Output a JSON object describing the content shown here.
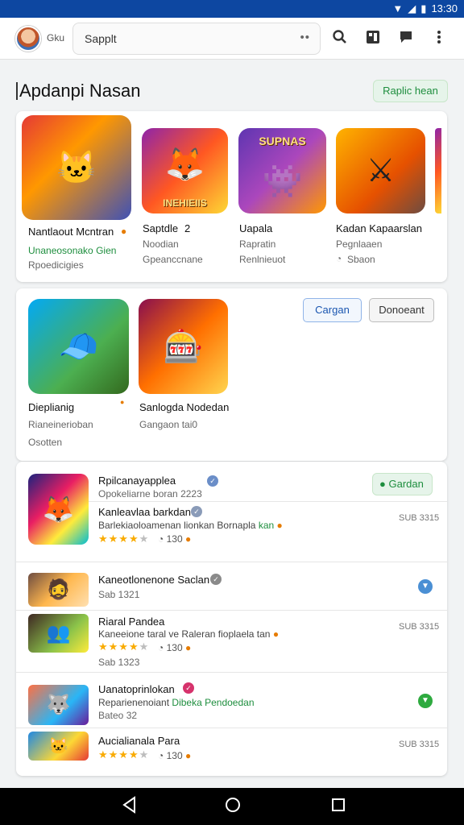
{
  "status": {
    "time": "13:30",
    "wifi_icon": "wifi-icon",
    "signal_icon": "signal-icon",
    "battery_icon": "battery-icon"
  },
  "appbar": {
    "account_label": "Gku",
    "search_value": "Sapplt",
    "search_more": "••",
    "icons": [
      "search-icon",
      "apps-icon",
      "chat-icon",
      "more-vert-icon"
    ]
  },
  "featured": {
    "title": "Apdanpi Nasan",
    "action": "Raplic hean",
    "apps": [
      {
        "name": "Nantlaout Mcntran",
        "line2": "Unaneosonako Gien",
        "line3": "Rpoedicigies"
      },
      {
        "name": "Saptdle",
        "badge": "2",
        "line2": "Noodian",
        "line3": "Gpeanccnane"
      },
      {
        "name": "Uapala",
        "line2": "Rapratin",
        "line3": "Renlnieuot",
        "tile_label": "SUPNAS"
      },
      {
        "name": "Kadan Kapaarslan",
        "line2": "Pegnlaaen",
        "line3": "Sbaon"
      }
    ],
    "tile2_label": "INEHIEIIS"
  },
  "second": {
    "apps": [
      {
        "name": "Dieplianig",
        "line2": "Rianeinerioban",
        "line3": "Osotten"
      },
      {
        "name": "Sanlogda Nodedan",
        "line2": "Gangaon tai0"
      }
    ],
    "btn1": "Cargan",
    "btn2": "Donoeant"
  },
  "list": [
    {
      "title": "Rpilcanayapplea",
      "sub": "Opokeliarne boran 2223",
      "name2": "Kanleavlaa barkdan",
      "desc": "Barlekiaoloamenan lionkan Bornapla",
      "desc_green": "kan",
      "rating": 4,
      "count": "130",
      "size": "SUB 3315",
      "action": "Gardan"
    },
    {
      "title": "Kaneotlonenone Saclan",
      "sub": "Sab 1321"
    },
    {
      "title": "Riaral Pandea",
      "desc": "Kaneeione taral ve Raleran fioplaela tan",
      "rating": 4,
      "count": "130",
      "sub": "Sab 1323",
      "size": "SUB 3315"
    },
    {
      "title": "Uanatoprinlokan",
      "desc": "Reparienenoiant",
      "desc_green": "Dibeka Pendoedan",
      "sub": "Bateo 32"
    },
    {
      "title": "Aucialianala Para",
      "rating": 4,
      "count": "130",
      "size": "SUB 3315"
    }
  ],
  "colors": {
    "accent_green": "#1e8e3e",
    "status_bar": "#0d47a1",
    "star": "#f9ab00"
  }
}
